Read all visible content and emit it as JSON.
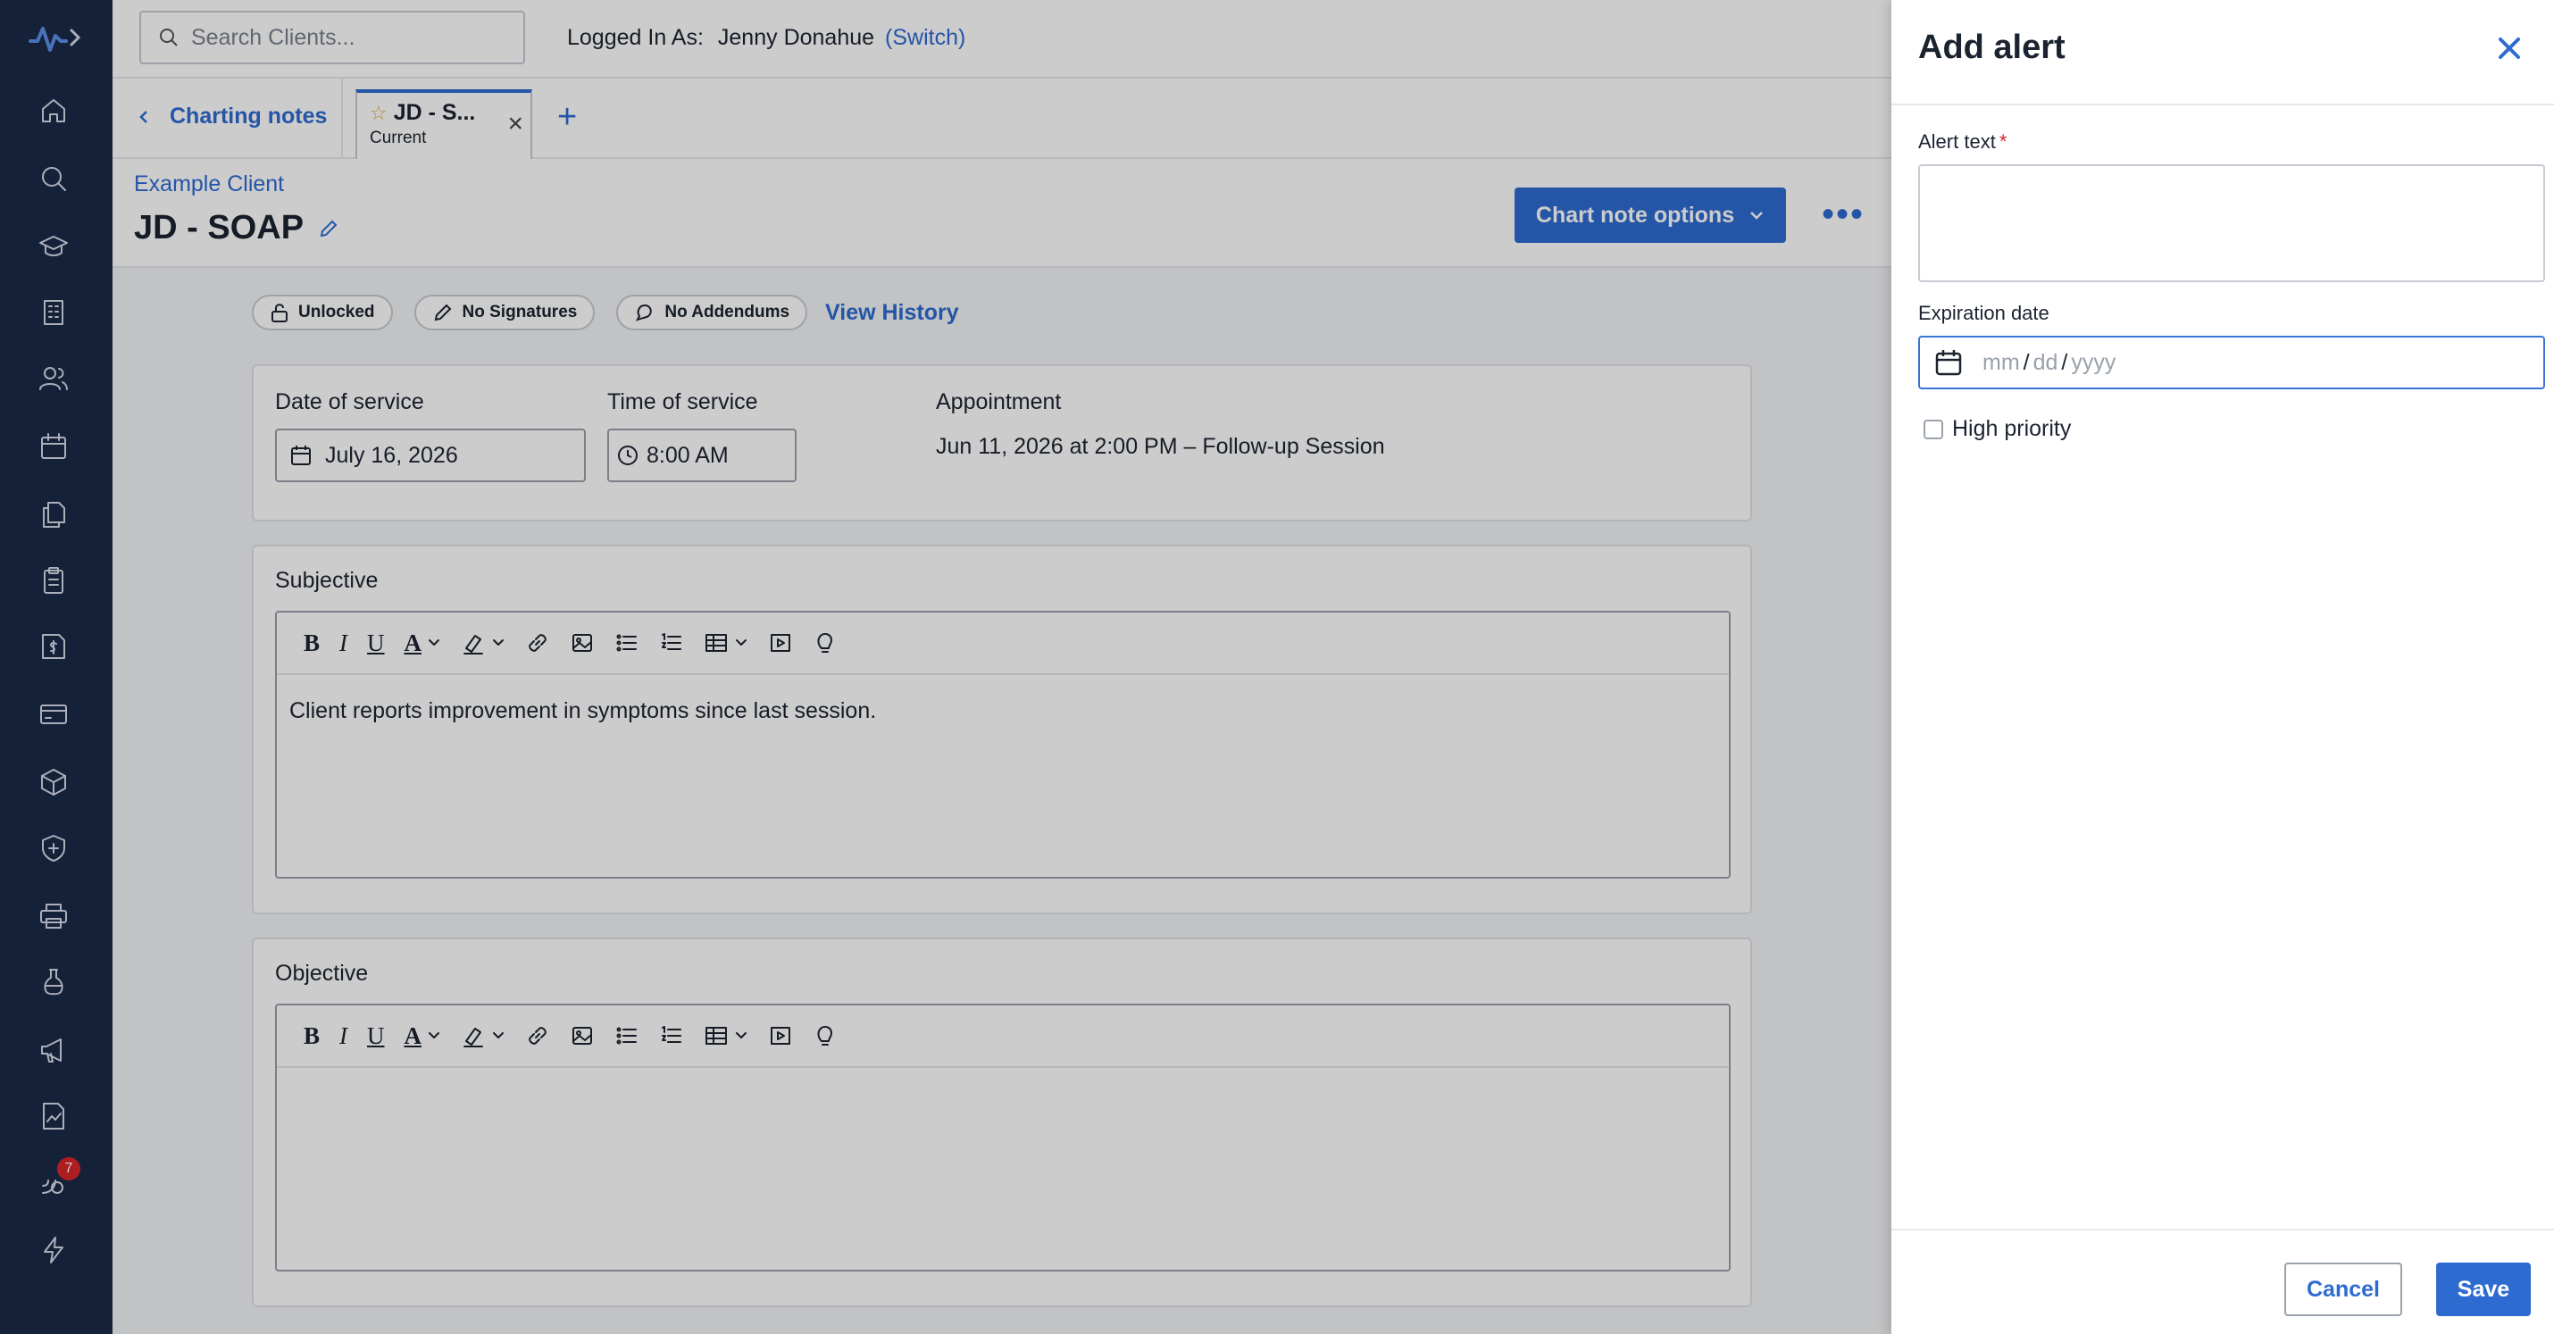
{
  "topbar": {
    "search_placeholder": "Search Clients...",
    "logged_label": "Logged In As:",
    "user_name": "Jenny Donahue",
    "switch_label": "(Switch)"
  },
  "tabs": {
    "back_label": "Charting notes",
    "active_tab_title": "JD - S...",
    "active_tab_sub": "Current"
  },
  "header": {
    "client_name": "Example Client",
    "title": "JD - SOAP",
    "options_label": "Chart note options"
  },
  "chips": {
    "lock": "Unlocked",
    "signatures": "No Signatures",
    "addendums": "No Addendums",
    "history": "View History"
  },
  "service": {
    "date_label": "Date of service",
    "date_value": "July 16, 2026",
    "time_label": "Time of service",
    "time_value": "8:00 AM",
    "appointment_label": "Appointment",
    "appointment_value": "Jun 11, 2026 at 2:00 PM – Follow-up Session"
  },
  "sections": {
    "subjective_label": "Subjective",
    "subjective_text": "Client reports improvement in symptoms since last session.",
    "objective_label": "Objective",
    "objective_text": ""
  },
  "toolbar": {
    "bold": "B",
    "italic": "I",
    "underline": "U",
    "color": "A"
  },
  "sidebar": {
    "badge_count": "7"
  },
  "drawer": {
    "title": "Add alert",
    "alert_text_label": "Alert text",
    "required_mark": "*",
    "expiration_label": "Expiration date",
    "date_mm": "mm",
    "date_dd": "dd",
    "date_yyyy": "yyyy",
    "date_sep": "/",
    "high_priority_label": "High priority",
    "cancel_label": "Cancel",
    "save_label": "Save"
  }
}
